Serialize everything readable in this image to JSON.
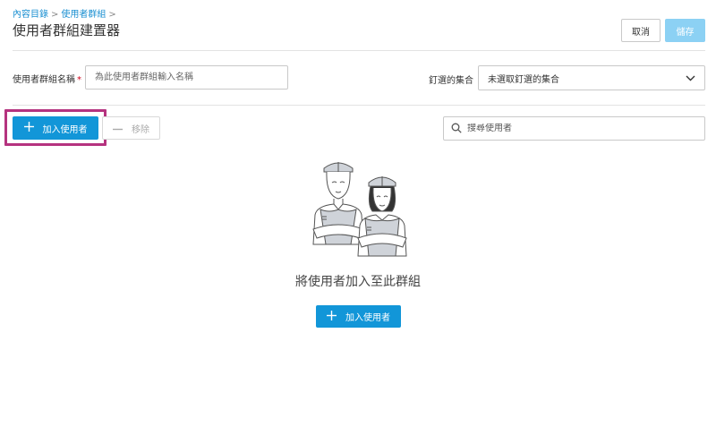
{
  "breadcrumb": {
    "items": [
      "內容目錄",
      "使用者群組"
    ],
    "separator": ">"
  },
  "page": {
    "title": "使用者群組建置器"
  },
  "header_actions": {
    "cancel_label": "取消",
    "save_label": "儲存"
  },
  "form": {
    "name_label": "使用者群組名稱",
    "required_mark": "*",
    "name_placeholder": "為此使用者群組輸入名稱",
    "name_value": "",
    "collection_label": "釘選的集合",
    "collection_selected": "未選取釘選的集合"
  },
  "toolbar": {
    "add_label": "加入使用者",
    "remove_label": "移除",
    "search_placeholder": "搜尋使用者"
  },
  "empty_state": {
    "message": "將使用者加入至此群組",
    "add_label": "加入使用者"
  },
  "icons": {
    "plus": "plus-icon",
    "minus": "minus-icon",
    "search": "search-icon",
    "chevron": "chevron-down-icon"
  },
  "colors": {
    "primary": "#1296d8",
    "save_disabled": "#8cd1f4",
    "highlight": "#b5337f",
    "link": "#1a8fd1",
    "required": "#d0021b"
  }
}
